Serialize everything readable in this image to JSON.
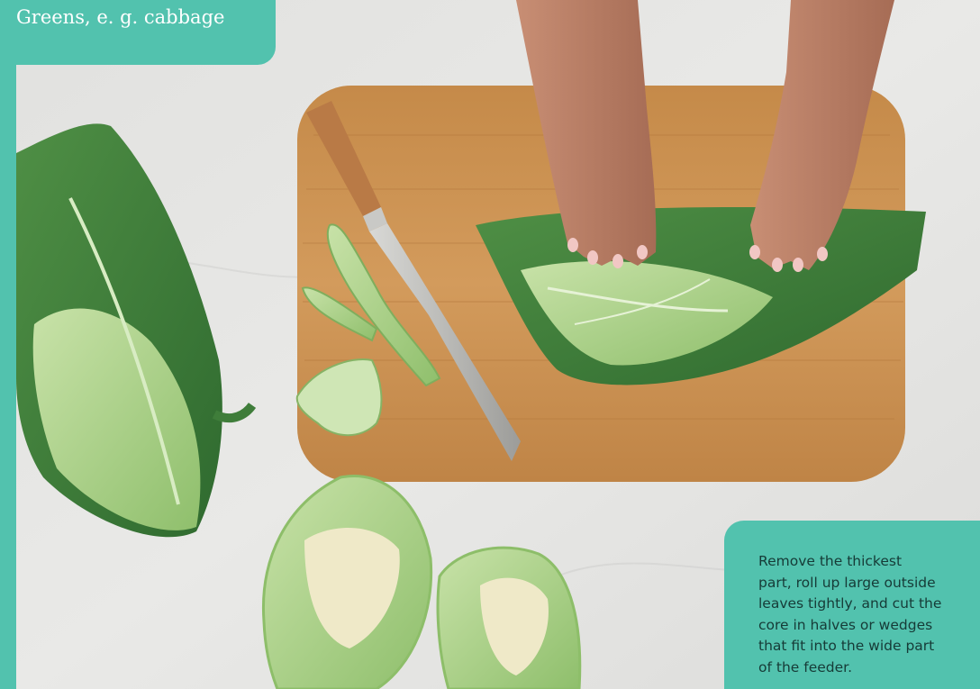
{
  "title_badge": {
    "text": "Greens, e. g. cabbage"
  },
  "caption": {
    "text": "Remove the thickest\npart, roll up large outside\nleaves tightly, and cut the\ncore in halves or wedges\nthat fit into the wide part\nof the feeder."
  },
  "colors": {
    "accent_teal": "#52c2ae",
    "caption_text": "#163b37",
    "title_text": "#ffffff",
    "marble_background": "#e4e4e2",
    "cutting_board": "#c98f4f",
    "cabbage_dark": "#3f7d3a",
    "cabbage_light": "#b5d69a"
  },
  "photo": {
    "subject": "hands rolling cabbage leaves on a wooden cutting board next to a knife, cabbage core pieces and cut cabbage wedges on a marble counter"
  }
}
